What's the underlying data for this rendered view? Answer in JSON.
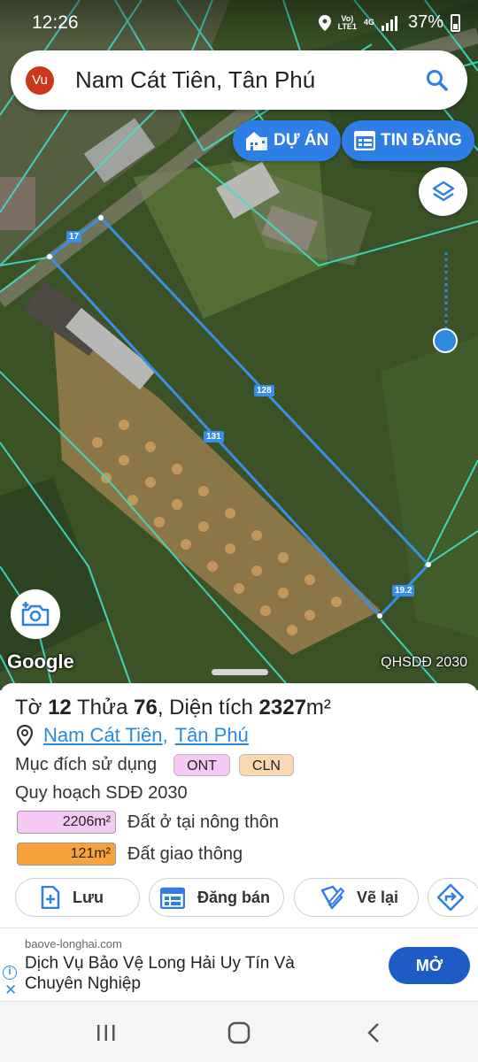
{
  "status_bar": {
    "time": "12:26",
    "network_top": "Vo)",
    "network_bottom": "LTE1",
    "signal_type": "4G",
    "battery": "37%"
  },
  "search": {
    "avatar_initials": "Vu",
    "title": "Nam Cát Tiên, Tân Phú",
    "icon": "search-icon"
  },
  "chips": {
    "du_an": "DỰ ÁN",
    "tin_dang": "TIN ĐĂNG"
  },
  "map": {
    "attribution": "Google",
    "layer_name": "QHSDĐ 2030",
    "dimensions": [
      "17",
      "128",
      "131",
      "19.2"
    ],
    "highlight_color": "#3a8ee8",
    "boundary_color": "#3fe0c8"
  },
  "parcel": {
    "sheet_label": "Tờ",
    "sheet_no": "12",
    "parcel_label": "Thửa",
    "parcel_no": "76",
    "area_label": ", Diện tích",
    "area_value": "2327",
    "area_unit": "m²",
    "commune": "Nam Cát Tiên",
    "district": "Tân Phú",
    "separator": ",",
    "purpose_label": "Mục đích sử dụng",
    "purpose_tags": [
      "ONT",
      "CLN"
    ],
    "plan_label": "Quy hoạch SDĐ 2030",
    "plan_rows": [
      {
        "area": "2206m²",
        "desc": "Đất ở tại nông thôn",
        "color": "#f6c8f5"
      },
      {
        "area": "121m²",
        "desc": "Đất giao thông",
        "color": "#f7a23a"
      }
    ]
  },
  "actions": {
    "save": "Lưu",
    "sell": "Đăng bán",
    "redraw": "Vẽ lại"
  },
  "ad": {
    "domain": "baove-longhai.com",
    "headline": "Dịch Vụ Bảo Vệ Long Hải Uy Tín Và Chuyên Nghiệp",
    "cta": "MỞ",
    "info_icon": "i",
    "close_icon": "✕"
  }
}
